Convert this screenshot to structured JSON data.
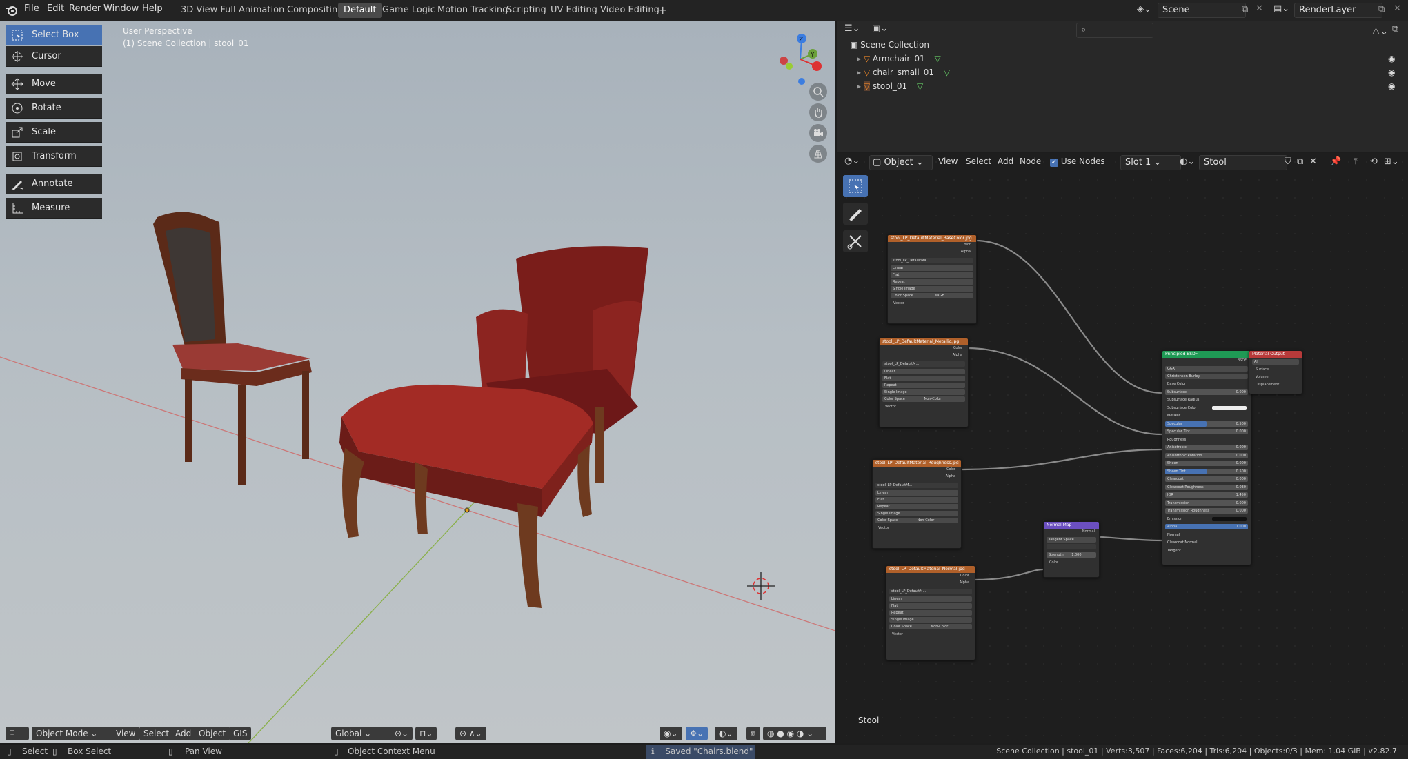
{
  "menu": [
    "File",
    "Edit",
    "Render",
    "Window",
    "Help"
  ],
  "workspaces": [
    "3D View Full",
    "Animation",
    "Compositing",
    "Default",
    "Game Logic",
    "Motion Tracking",
    "Scripting",
    "UV Editing",
    "Video Editing"
  ],
  "workspace_active": "Default",
  "scene_name": "Scene",
  "render_layer": "RenderLayer",
  "viewport": {
    "view_name": "User Perspective",
    "view_collection": "(1) Scene Collection | stool_01",
    "tools": [
      "Select Box",
      "Cursor",
      "Move",
      "Rotate",
      "Scale",
      "Transform",
      "Annotate",
      "Measure"
    ],
    "header": {
      "mode": "Object Mode",
      "view": "View",
      "select": "Select",
      "add": "Add",
      "object": "Object",
      "gis": "GIS",
      "orientation": "Global"
    },
    "axes": {
      "z": "Z",
      "y": "Y"
    }
  },
  "outliner": {
    "root": "Scene Collection",
    "items": [
      "Armchair_01",
      "chair_small_01",
      "stool_01"
    ]
  },
  "node_editor": {
    "type": "Object",
    "view": "View",
    "select": "Select",
    "add": "Add",
    "node": "Node",
    "use_nodes": "Use Nodes",
    "slot": "Slot 1",
    "material": "Stool",
    "footer_label": "Stool",
    "tex_nodes": [
      {
        "title": "stool_LP_DefaultMaterial_BaseColor.jpg",
        "img": "stool_LP_DefaultMa...",
        "colorspace": "sRGB"
      },
      {
        "title": "stool_LP_DefaultMaterial_Metallic.jpg",
        "img": "stool_LP_DefaultM...",
        "colorspace": "Non-Color"
      },
      {
        "title": "stool_LP_DefaultMaterial_Roughness.jpg",
        "img": "stool_LP_DefaultM...",
        "colorspace": "Non-Color"
      },
      {
        "title": "stool_LP_DefaultMaterial_Normal.jpg",
        "img": "stool_LP_DefaultM...",
        "colorspace": "Non-Color"
      }
    ],
    "tex_fields": [
      "Linear",
      "Flat",
      "Repeat",
      "Single Image",
      "Color Space"
    ],
    "tex_outputs": [
      "Color",
      "Alpha"
    ],
    "tex_input": "Vector",
    "normal_map": {
      "title": "Normal Map",
      "out": "Normal",
      "space": "Tangent Space",
      "strength_label": "Strength",
      "strength": "1.000",
      "in": "Color"
    },
    "bsdf": {
      "title": "Principled BSDF",
      "out": "BSDF",
      "dist": "GGX",
      "sss": "Christensen-Burley",
      "inputs": [
        [
          "Base Color",
          ""
        ],
        [
          "Subsurface",
          "0.000"
        ],
        [
          "Subsurface Radius",
          ""
        ],
        [
          "Subsurface Color",
          ""
        ],
        [
          "Metallic",
          ""
        ],
        [
          "Specular",
          "0.500"
        ],
        [
          "Specular Tint",
          "0.000"
        ],
        [
          "Roughness",
          ""
        ],
        [
          "Anisotropic",
          "0.000"
        ],
        [
          "Anisotropic Rotation",
          "0.000"
        ],
        [
          "Sheen",
          "0.000"
        ],
        [
          "Sheen Tint",
          "0.500"
        ],
        [
          "Clearcoat",
          "0.000"
        ],
        [
          "Clearcoat Roughness",
          "0.030"
        ],
        [
          "IOR",
          "1.450"
        ],
        [
          "Transmission",
          "0.000"
        ],
        [
          "Transmission Roughness",
          "0.000"
        ],
        [
          "Emission",
          ""
        ],
        [
          "Alpha",
          "1.000"
        ],
        [
          "Normal",
          ""
        ],
        [
          "Clearcoat Normal",
          ""
        ],
        [
          "Tangent",
          ""
        ]
      ]
    },
    "output": {
      "title": "Material Output",
      "target": "All",
      "inputs": [
        "Surface",
        "Volume",
        "Displacement"
      ]
    }
  },
  "status": {
    "select": "Select",
    "box_select": "Box Select",
    "pan_view": "Pan View",
    "context_menu": "Object Context Menu",
    "saved": "Saved \"Chairs.blend\"",
    "stats": "Scene Collection | stool_01 | Verts:3,507 | Faces:6,204 | Tris:6,204 | Objects:0/3 | Mem: 1.04 GiB | v2.82.7"
  },
  "colors": {
    "accent": "#4772b3",
    "tex_header": "#b0602a",
    "bsdf_header": "#1f9a55",
    "output_header": "#b83a3a",
    "normal_header": "#6b4fc0"
  }
}
